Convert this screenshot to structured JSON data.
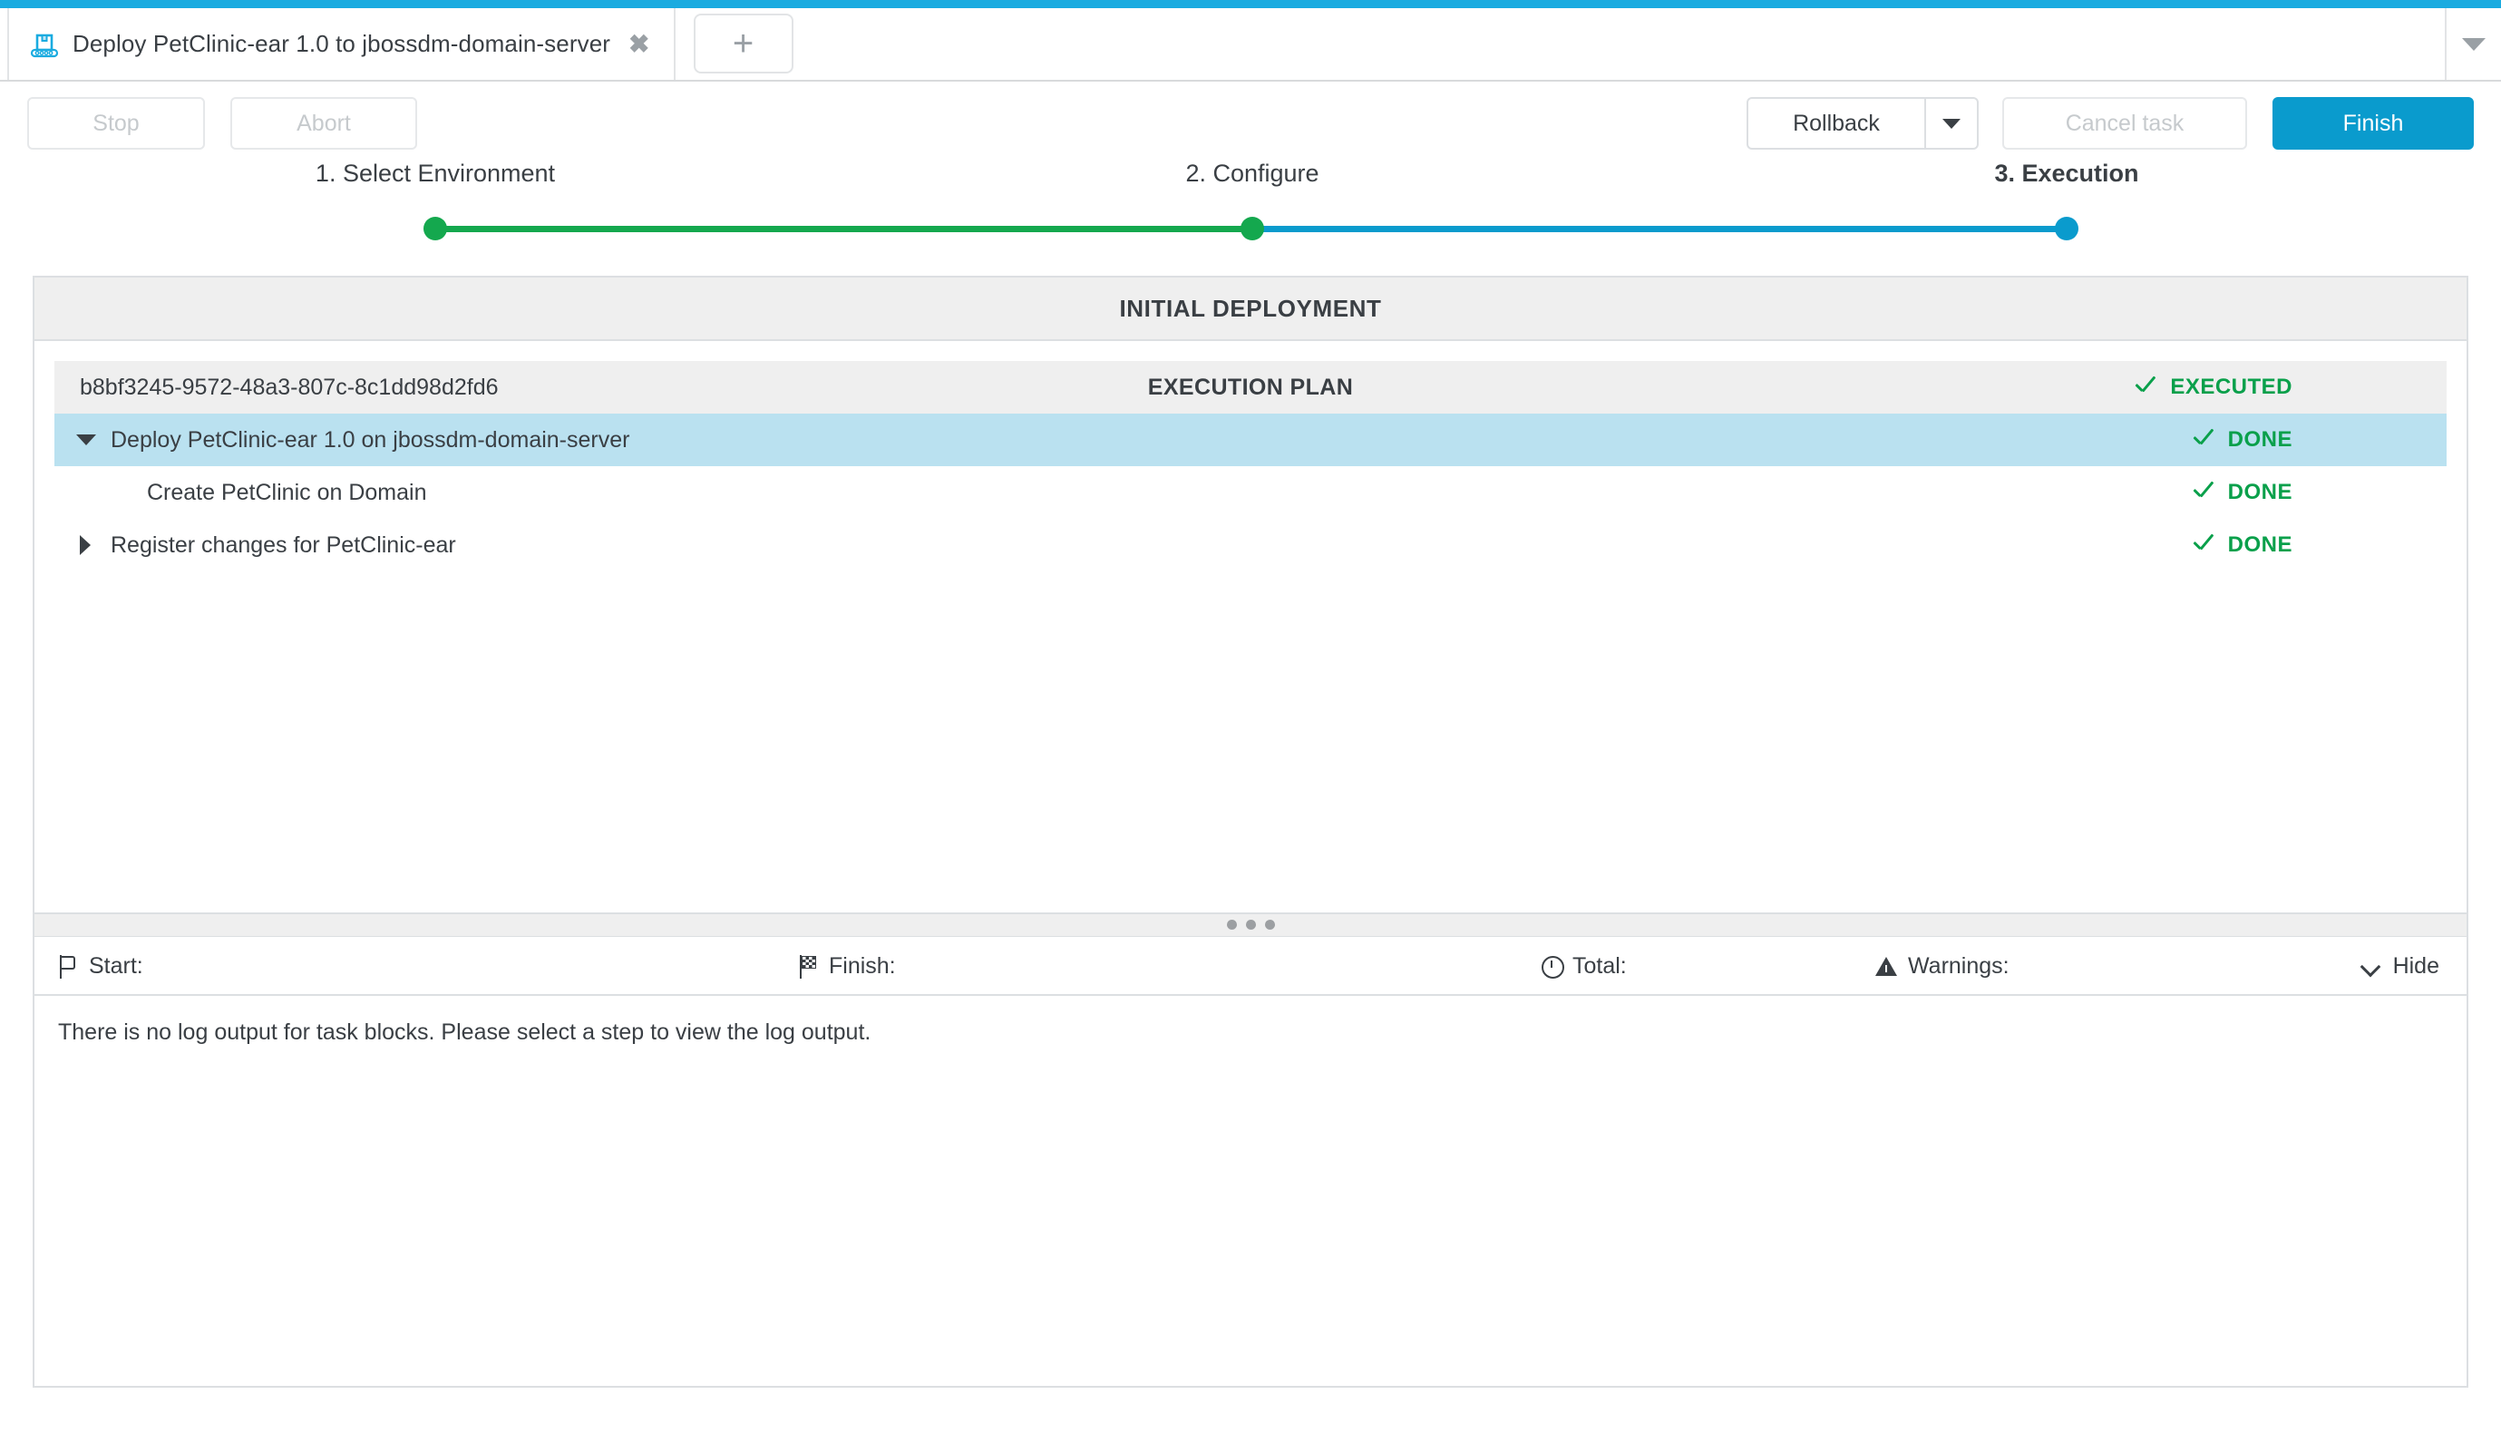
{
  "window": {
    "accent_color": "#1aabe0"
  },
  "tabbar": {
    "tabs": [
      {
        "title": "Deploy PetClinic-ear 1.0 to jbossdm-domain-server",
        "icon": "deploy-package-icon",
        "close_label": "✖"
      }
    ],
    "new_tab_label": "+",
    "overflow_icon": "chevron-down-icon"
  },
  "toolbar": {
    "stop_label": "Stop",
    "abort_label": "Abort",
    "rollback_label": "Rollback",
    "rollback_caret_icon": "caret-down-icon",
    "cancel_task_label": "Cancel task",
    "finish_label": "Finish",
    "primary_color": "#0a9bcd"
  },
  "stepper": {
    "steps": [
      {
        "label": "1. Select Environment",
        "state": "complete",
        "color": "#14a84e"
      },
      {
        "label": "2. Configure",
        "state": "complete",
        "color": "#14a84e"
      },
      {
        "label": "3. Execution",
        "state": "current",
        "color": "#0a9bcd"
      }
    ]
  },
  "panel": {
    "header": "INITIAL DEPLOYMENT",
    "plan_row": {
      "id": "b8bf3245-9572-48a3-807c-8c1dd98d2fd6",
      "center_label": "EXECUTION PLAN",
      "status": "EXECUTED"
    },
    "rows": [
      {
        "label": "Deploy PetClinic-ear 1.0 on jbossdm-domain-server",
        "status": "DONE",
        "twisty": "expanded",
        "indent": 0,
        "selected": true
      },
      {
        "label": "Create PetClinic on Domain",
        "status": "DONE",
        "twisty": "none",
        "indent": 1,
        "selected": false
      },
      {
        "label": "Register changes for PetClinic-ear",
        "status": "DONE",
        "twisty": "collapsed",
        "indent": 0,
        "selected": false
      }
    ],
    "status_color": "#0aa04b"
  },
  "statusbar": {
    "start_label": "Start:",
    "start_value": "",
    "finish_label": "Finish:",
    "finish_value": "",
    "total_label": "Total:",
    "total_value": "",
    "warnings_label": "Warnings:",
    "warnings_value": "",
    "hide_label": "Hide"
  },
  "log": {
    "message": "There is no log output for task blocks. Please select a step to view the log output."
  }
}
